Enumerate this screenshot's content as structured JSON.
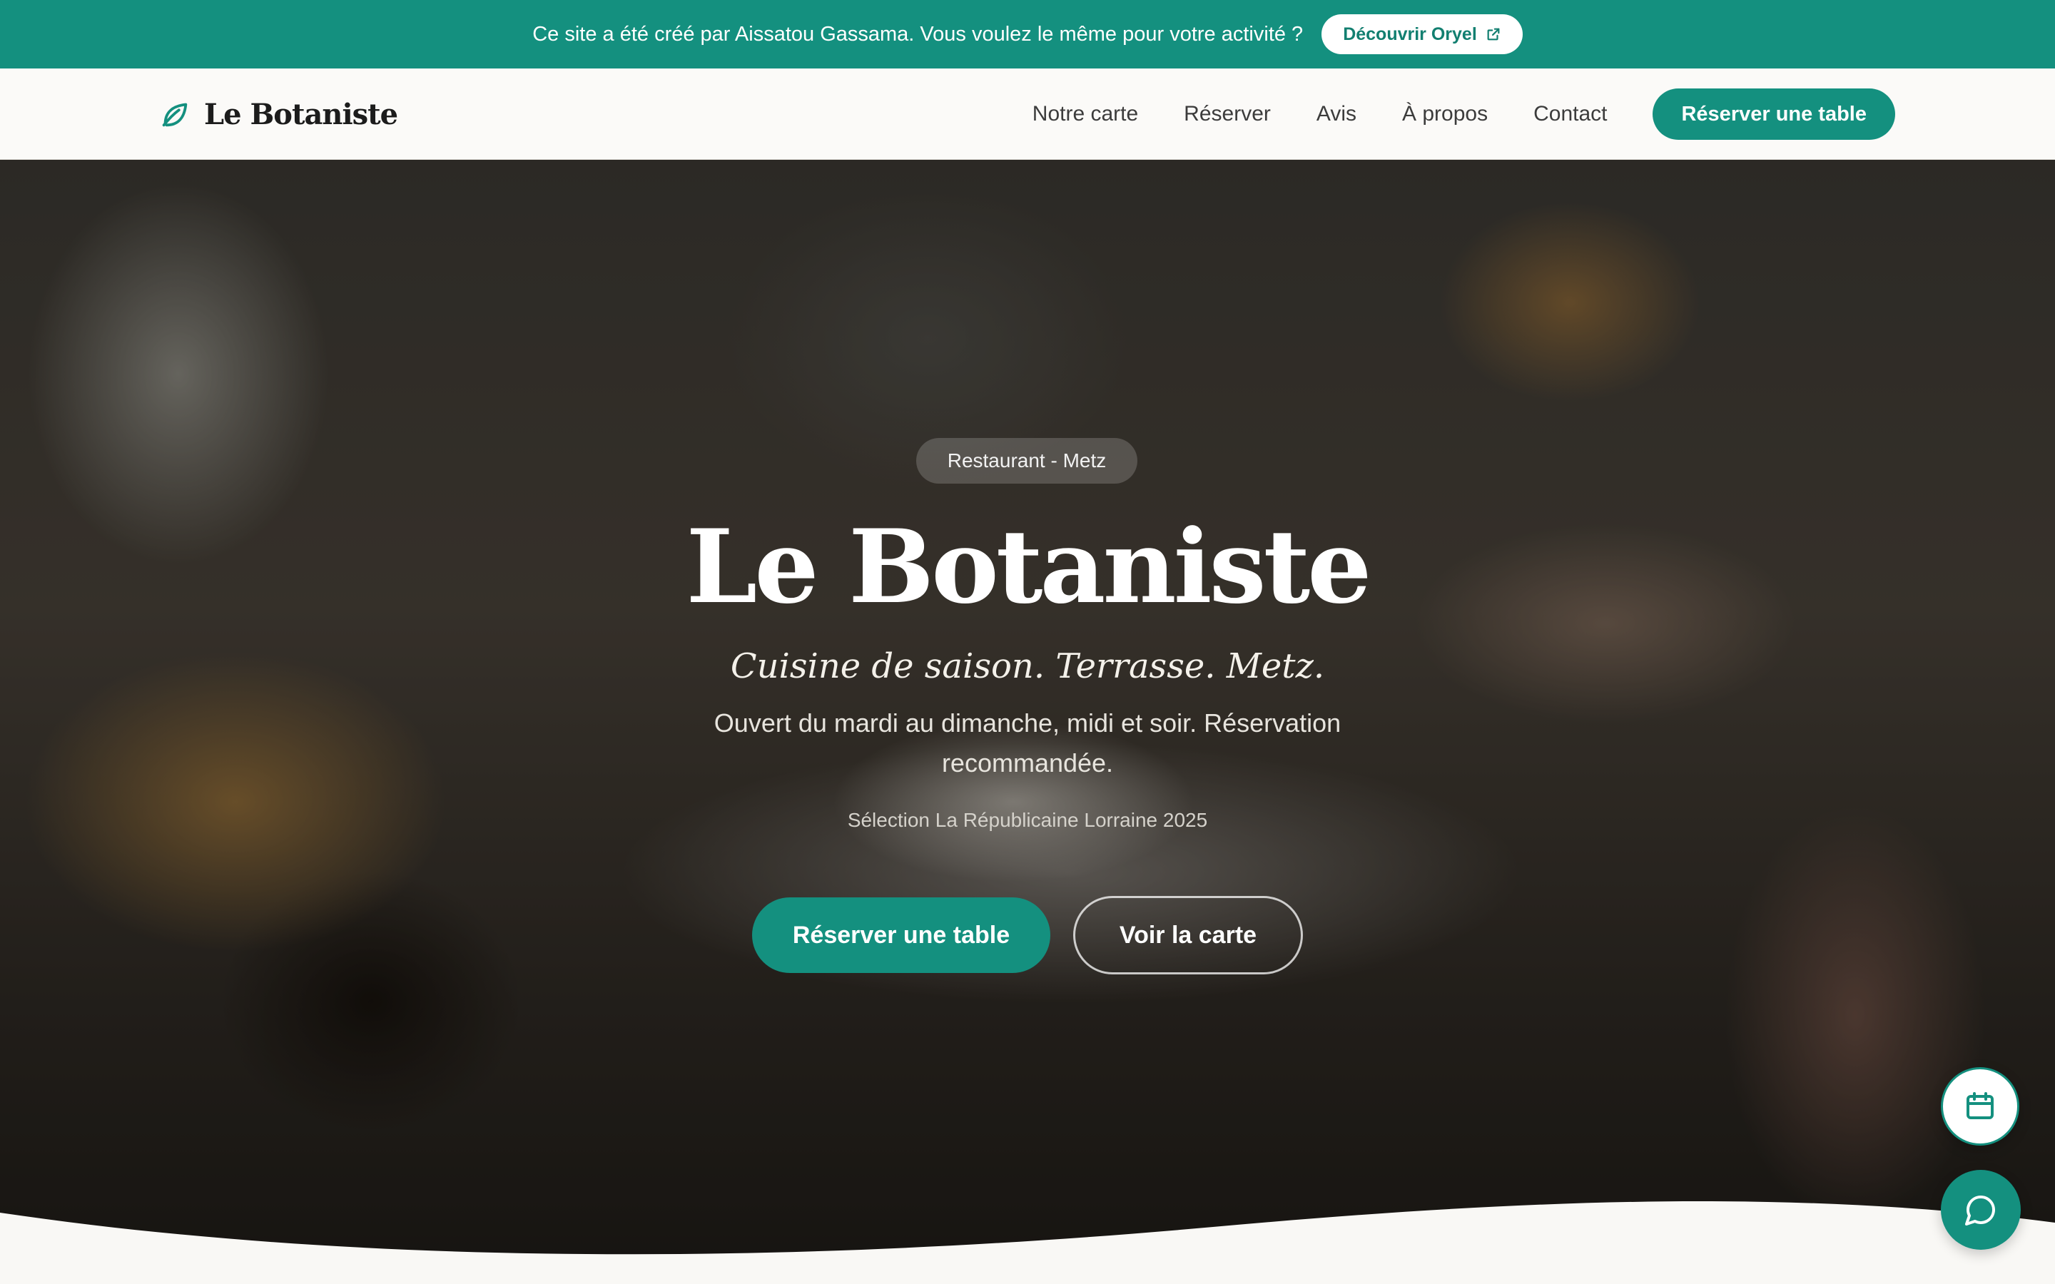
{
  "announcement": {
    "text": "Ce site a été créé par Aissatou Gassama. Vous voulez le même pour votre activité ?",
    "button_label": "Découvrir Oryel",
    "button_icon": "external-link-icon"
  },
  "header": {
    "brand_name": "Le Botaniste",
    "brand_icon": "leaf-icon",
    "nav": [
      "Notre carte",
      "Réserver",
      "Avis",
      "À propos",
      "Contact"
    ],
    "cta_label": "Réserver une table"
  },
  "hero": {
    "badge": "Restaurant - Metz",
    "title": "Le Botaniste",
    "tagline": "Cuisine de saison. Terrasse. Metz.",
    "description": "Ouvert du mardi au dimanche, midi et soir. Réservation recommandée.",
    "award": "Sélection La Républicaine Lorraine 2025",
    "primary_cta": "Réserver une table",
    "secondary_cta": "Voir la carte"
  },
  "floating": {
    "calendar_icon": "calendar-icon",
    "chat_icon": "chat-icon"
  },
  "colors": {
    "accent": "#14907f",
    "background": "#f9f8f5"
  }
}
